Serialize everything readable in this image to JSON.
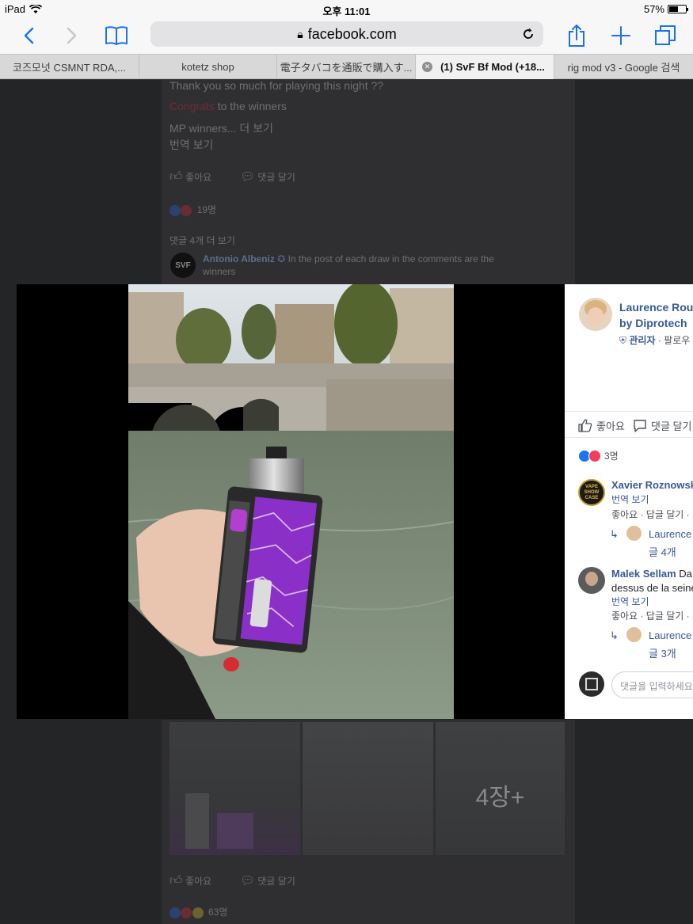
{
  "status_bar": {
    "device": "iPad",
    "time": "오후 11:01",
    "battery": "57%",
    "battery_level": 0.57
  },
  "toolbar": {
    "url": "facebook.com"
  },
  "tabs": [
    {
      "label": "코즈모넛 CSMNT RDA,...",
      "active": false
    },
    {
      "label": "kotetz shop",
      "active": false
    },
    {
      "label": "電子タバコを通販で購入す...",
      "active": false
    },
    {
      "label": "(1) SvF Bf Mod (+18...",
      "active": true
    },
    {
      "label": "rig mod v3 - Google 검색",
      "active": false
    }
  ],
  "feed": {
    "post_line_1": "Thank you so much for playing this night ??",
    "congrats_link": "Congrats",
    "congrats_rest": " to the winners",
    "mp_winners": "MP winners... 더 보기",
    "translate": "번역 보기",
    "like": "좋아요",
    "comment": "댓글 달기",
    "reactions_count": "19명",
    "more_comments": "댓글 4개 더 보기",
    "commenter_name": "Antonio Albeniz",
    "commenter_badge": "SVF",
    "commenter_text": " In the post of each draw in the comments are the",
    "commenter_text_2": "winners",
    "gallery_more": "4장+",
    "like_2": "좋아요",
    "comment_2": "댓글 달기",
    "reactions_count_2": "63명"
  },
  "side_panel": {
    "author_line_1": "Laurence Rou",
    "author_line_2": "by Diprotech",
    "admin_label": "관리자",
    "follow": "팔로우",
    "like": "좋아요",
    "comment": "댓글 달기",
    "reactions": "3명",
    "comments": [
      {
        "name": "Xavier Roznowsk",
        "avatar_text": "VAPE SHOW CASE",
        "translate": "번역 보기",
        "actions": "좋아요 · 답글 달기 ·",
        "reply_name": "Laurence",
        "reply_count": "글 4개"
      },
      {
        "name": "Malek Sellam",
        "text_inline": "Da",
        "text_line_2": "dessus de la seine",
        "translate": "번역 보기",
        "actions": "좋아요 · 답글 달기 ·",
        "reply_name": "Laurence",
        "reply_count": "글 3개"
      }
    ],
    "input_placeholder": "댓글을 입력하세요..."
  },
  "colors": {
    "accent": "#1a73e8",
    "facebook_blue": "#385898",
    "like_blue": "#1877f2",
    "love_red": "#f33e58",
    "mod_purple": "#8a2fc8"
  }
}
